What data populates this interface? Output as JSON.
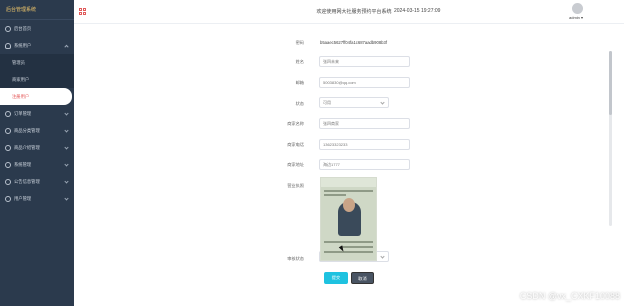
{
  "sidebar": {
    "title": "后台管理系统",
    "items": [
      {
        "label": "后台首页",
        "icon": "home-icon"
      },
      {
        "label": "系统用户",
        "icon": "user-icon",
        "expanded": true
      },
      {
        "label": "管理员",
        "sub": true
      },
      {
        "label": "商家用户",
        "sub": true
      },
      {
        "label": "注册用户",
        "sub": true,
        "active": true
      },
      {
        "label": "订单管理",
        "icon": "order-icon"
      },
      {
        "label": "商品分类管理",
        "icon": "category-icon"
      },
      {
        "label": "商品介绍管理",
        "icon": "goods-icon"
      },
      {
        "label": "系统管理",
        "icon": "settings-icon"
      },
      {
        "label": "公告信息管理",
        "icon": "notice-icon"
      },
      {
        "label": "用户管理",
        "icon": "people-icon"
      }
    ]
  },
  "header": {
    "title": "欢迎使用网大社服务预约平台系统",
    "datetime": "2024-03-15 19:27:09",
    "user": "admin"
  },
  "form": {
    "password_label": "密码",
    "password_value": "b5aaec5627ff04fa1c687aadb908b3f",
    "name_label": "姓名",
    "name_value": "张四未来",
    "email_label": "邮箱",
    "email_value": "5003830@qq.com",
    "status_label": "状态",
    "status_value": "可用",
    "merchant_name_label": "商家名称",
    "merchant_name_value": "张四商家",
    "merchant_phone_label": "商家电话",
    "merchant_phone_value": "13623323233",
    "merchant_address_label": "商家地址",
    "merchant_address_value": "海边1777",
    "license_label": "营业执照",
    "review_label": "审核状态",
    "review_value": "未审核"
  },
  "buttons": {
    "save": "提交",
    "cancel": "取消"
  },
  "watermark": "CSDN @vx_CXKF10088",
  "colors": {
    "sidebar_bg": "#2b3a4d",
    "accent": "#1ec2e0",
    "active_text": "#e45656"
  }
}
